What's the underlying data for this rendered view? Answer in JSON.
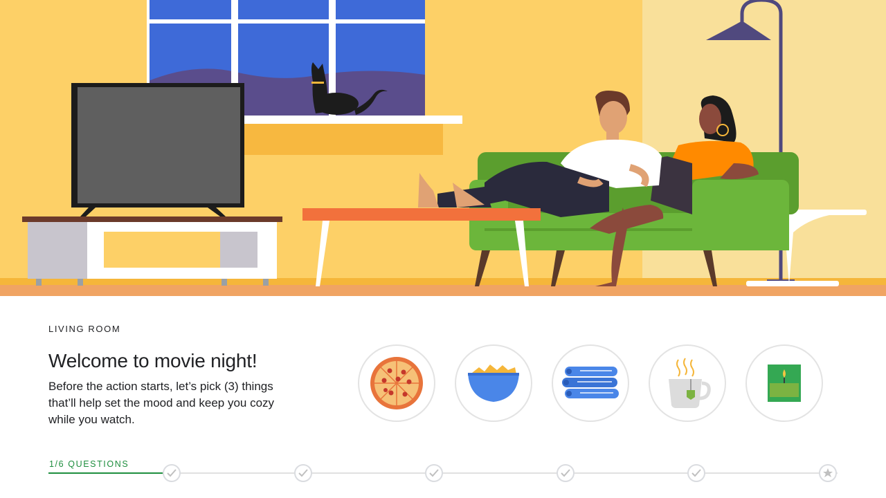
{
  "section": {
    "label": "LIVING ROOM"
  },
  "intro": {
    "headline": "Welcome to movie night!",
    "description": "Before the action starts, let’s pick (3) things that’ll help set the mood and keep you cozy while you watch."
  },
  "choices": [
    {
      "icon": "pizza-icon"
    },
    {
      "icon": "chips-bowl-icon"
    },
    {
      "icon": "blanket-icon"
    },
    {
      "icon": "tea-mug-icon"
    },
    {
      "icon": "candle-icon"
    }
  ],
  "progress": {
    "label": "1/6 QUESTIONS",
    "current": 1,
    "total": 6,
    "steps": [
      "check-icon",
      "check-icon",
      "check-icon",
      "check-icon",
      "check-icon",
      "star-icon"
    ]
  },
  "colors": {
    "wall_left": "#fdd067",
    "wall_right": "#f9e09a",
    "window_sky": "#3e6ad8",
    "sofa": "#6cb63b",
    "accent_green": "#1e8e3e",
    "table_top": "#f2713c",
    "floor": "#f0a463"
  }
}
